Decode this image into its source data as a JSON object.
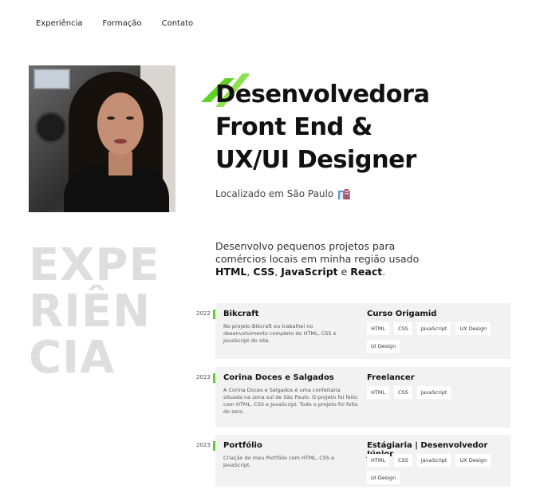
{
  "nav": {
    "items": [
      "Experiência",
      "Formação",
      "Contato"
    ]
  },
  "hero": {
    "title_lines": [
      "Desenvolvedora",
      "Front End &",
      "UX/UI Designer"
    ],
    "location": "Localizado em São Paulo",
    "location_icon": "building-icon",
    "photo_icon": "profile-photo",
    "accent_color": "#5fd325"
  },
  "intro": {
    "text_start": "Desenvolvo pequenos projetos para comércios locais em minha região usado ",
    "html": "HTML",
    "comma1": ", ",
    "css": "CSS",
    "comma2": ",",
    "javascript": "JavaScript",
    "and": " e ",
    "react": "React",
    "period": "."
  },
  "section_word": {
    "lines": [
      "EXPE",
      "RIÊN",
      "CIA"
    ]
  },
  "experience": [
    {
      "year": "2022",
      "project": "Bikcraft",
      "description": "No projeto Bikcraft eu trabalhei no desenvolvimento completo do HTML, CSS e JavaScript do site.",
      "role": "Curso Origamid",
      "tags": [
        "HTML",
        "CSS",
        "JavaScript",
        "UX Design",
        "UI Design"
      ]
    },
    {
      "year": "2023",
      "project": "Corina Doces e Salgados",
      "description": "A Corina Doces e Salgados é uma confeitaria situada na zona sul de São Paulo. O projeto foi feito com HTML, CSS e JavaScript. Todo o projeto foi feito do zero.",
      "role": "Freelancer",
      "tags": [
        "HTML",
        "CSS",
        "JavaScript"
      ]
    },
    {
      "year": "2023",
      "project": "Portfólio",
      "description": "Criação do meu Portfólio com HTML, CSS e JavaScript.",
      "role": "Estágiaria | Desenvolvedor Júnior",
      "tags": [
        "HTML",
        "CSS",
        "JavaScript",
        "UX Design",
        "UI Design"
      ]
    }
  ]
}
